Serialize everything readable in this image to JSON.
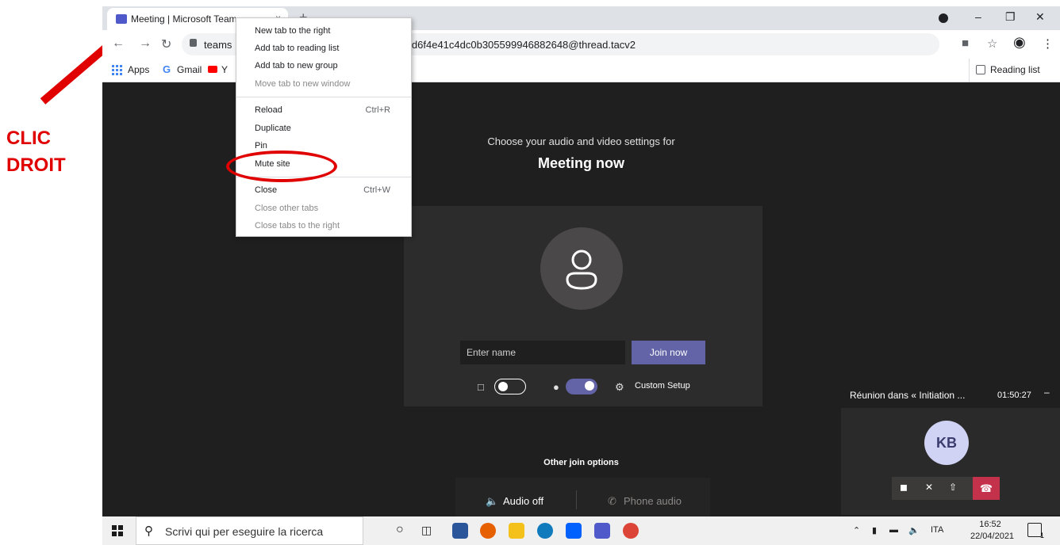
{
  "annotation": {
    "label_line1": "CLIC",
    "label_line2": "DROIT",
    "color": "#e00000"
  },
  "browser": {
    "tab_title": "Meeting | Microsoft Team",
    "tab_close": "×",
    "new_tab": "+",
    "url_start": "teams",
    "url_end": "e7d7d6f4e41c4dc0b305599946882648@thread.tacv2",
    "bookmarks": {
      "apps": "Apps",
      "gmail": "Gmail",
      "youtube_partial": "Y"
    },
    "reading_list": "Reading list"
  },
  "context_menu": {
    "items": [
      {
        "label": "New tab to the right",
        "shortcut": "",
        "disabled": false
      },
      {
        "label": "Add tab to reading list",
        "shortcut": "",
        "disabled": false
      },
      {
        "label": "Add tab to new group",
        "shortcut": "",
        "disabled": false
      },
      {
        "label": "Move tab to new window",
        "shortcut": "",
        "disabled": true
      },
      {
        "label": "Reload",
        "shortcut": "Ctrl+R",
        "disabled": false
      },
      {
        "label": "Duplicate",
        "shortcut": "",
        "disabled": false
      },
      {
        "label": "Pin",
        "shortcut": "",
        "disabled": false
      },
      {
        "label": "Mute site",
        "shortcut": "",
        "disabled": false
      },
      {
        "label": "Close",
        "shortcut": "Ctrl+W",
        "disabled": false
      },
      {
        "label": "Close other tabs",
        "shortcut": "",
        "disabled": true
      },
      {
        "label": "Close tabs to the right",
        "shortcut": "",
        "disabled": true
      }
    ]
  },
  "teams": {
    "choose_text": "Choose your audio and video settings for",
    "meeting_title": "Meeting now",
    "name_placeholder": "Enter name",
    "join_button": "Join now",
    "custom_setup": "Custom Setup",
    "camera_on": false,
    "mic_on": true,
    "accent_color": "#6264a7",
    "other_options": "Other join options",
    "audio_off": "Audio off",
    "phone_audio": "Phone audio"
  },
  "mini_window": {
    "title": "Réunion dans « Initiation ...",
    "time": "01:50:27",
    "minimize": "–",
    "initials": "KB",
    "hangup_color": "#c4314b"
  },
  "taskbar": {
    "search_placeholder": "Scrivi qui per eseguire la ricerca",
    "language": "ITA",
    "time": "16:52",
    "date": "22/04/2021",
    "notif_count": "1"
  }
}
